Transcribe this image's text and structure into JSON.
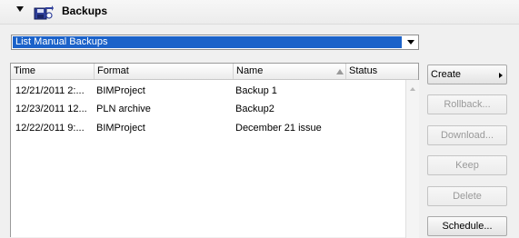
{
  "panel": {
    "title": "Backups",
    "icons": {
      "collapse": "collapse-triangle-icon",
      "backup": "backup-teamwork-icon"
    }
  },
  "filter": {
    "selected": "List Manual Backups"
  },
  "table": {
    "columns": [
      "Time",
      "Format",
      "Name",
      "Status"
    ],
    "sort_column": "Name",
    "rows": [
      {
        "time": "12/21/2011 2:...",
        "format": "BIMProject",
        "name": "Backup 1",
        "status": ""
      },
      {
        "time": "12/23/2011 12...",
        "format": "PLN archive",
        "name": "Backup2",
        "status": ""
      },
      {
        "time": "12/22/2011 9:...",
        "format": "BIMProject",
        "name": "December 21 issue",
        "status": ""
      }
    ]
  },
  "buttons": {
    "create": "Create",
    "rollback": "Rollback...",
    "download": "Download...",
    "keep": "Keep",
    "delete": "Delete",
    "schedule": "Schedule..."
  },
  "colors": {
    "selection": "#1b62c9",
    "background": "#f0f0f0",
    "disabled_text": "#9a9a9a"
  }
}
